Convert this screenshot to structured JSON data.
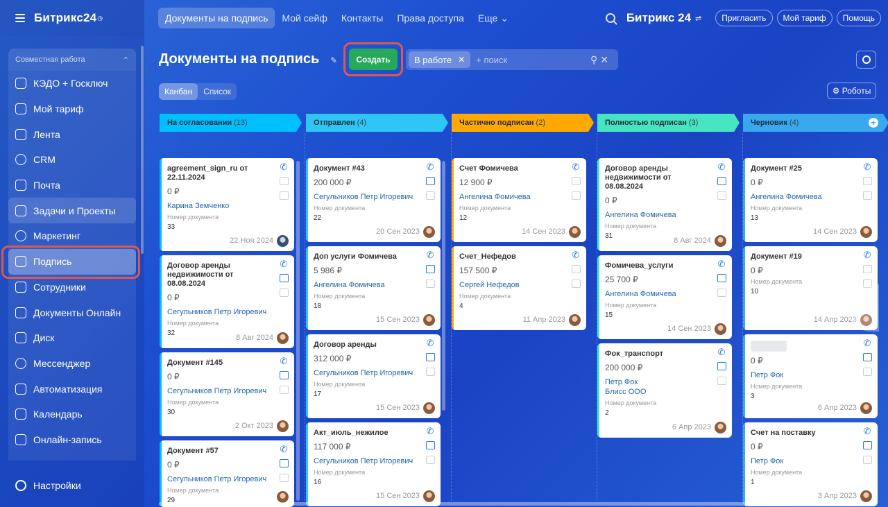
{
  "app": {
    "logo": "Битрикс24",
    "brand": "Битрикс 24"
  },
  "topnav": [
    "Документы на подпись",
    "Мой сейф",
    "Контакты",
    "Права доступа",
    "Еще ⌄"
  ],
  "topright": {
    "invite": "Пригласить",
    "tariff": "Мой тариф",
    "help": "Помощь"
  },
  "sidebar": {
    "group_label": "Совместная работа",
    "items": [
      {
        "label": "КЭДО + Госключ"
      },
      {
        "label": "Мой тариф"
      },
      {
        "label": "Лента"
      },
      {
        "label": "CRM"
      },
      {
        "label": "Почта"
      },
      {
        "label": "Задачи и Проекты"
      },
      {
        "label": "Маркетинг"
      },
      {
        "label": "Подпись"
      },
      {
        "label": "Сотрудники"
      },
      {
        "label": "Документы Онлайн"
      },
      {
        "label": "Диск"
      },
      {
        "label": "Мессенджер"
      },
      {
        "label": "Автоматизация"
      },
      {
        "label": "Календарь"
      },
      {
        "label": "Онлайн-запись"
      }
    ],
    "settings": "Настройки"
  },
  "page": {
    "title": "Документы на подпись",
    "create": "Создать",
    "filter_tag": "В работе",
    "search_placeholder": "+ поиск",
    "view_kanban": "Канбан",
    "view_list": "Список",
    "robots": "Роботы"
  },
  "columns": [
    {
      "name": "На согласовании",
      "count": "(13)",
      "color": "#00bfff"
    },
    {
      "name": "Отправлен",
      "count": "(4)",
      "color": "#2fc6f6"
    },
    {
      "name": "Частично подписан",
      "count": "(2)",
      "color": "#ffa900"
    },
    {
      "name": "Полностью подписан",
      "count": "(3)",
      "color": "#47e4c2"
    },
    {
      "name": "Черновик",
      "count": "(4)",
      "color": "#39a8ef"
    }
  ],
  "field_label": "Номер документа",
  "cards": [
    [
      {
        "title": "agreement_sign_ru от 22.11.2024",
        "sum": "0 ₽",
        "person": "Карина Земченко",
        "num": "33",
        "date": "22 Ноя 2024"
      },
      {
        "title": "Договор аренды недвижимости от 08.08.2024",
        "sum": "0 ₽",
        "person": "Сегульников Петр Игоревич",
        "num": "32",
        "date": "8 Авг 2024"
      },
      {
        "title": "Документ #145",
        "sum": "0 ₽",
        "person": "Сегульников Петр Игоревич",
        "num": "30",
        "date": "2 Окт 2023"
      },
      {
        "title": "Документ #57",
        "sum": "0 ₽",
        "person": "Сегульников Петр Игоревич",
        "num": "29",
        "date": ""
      }
    ],
    [
      {
        "title": "Документ #43",
        "sum": "200 000 ₽",
        "person": "Сегульников Петр Игоревич",
        "num": "22",
        "date": "20 Сен 2023"
      },
      {
        "title": "Доп услуги Фомичева",
        "sum": "5 986 ₽",
        "person": "Ангелина Фомичева",
        "num": "18",
        "date": "15 Сен 2023"
      },
      {
        "title": "Договор аренды",
        "sum": "312 000 ₽",
        "person": "Сегульников Петр Игоревич",
        "num": "17",
        "date": "15 Сен 2023"
      },
      {
        "title": "Акт_июль_нежилое",
        "sum": "117 000 ₽",
        "person": "Сегульников Петр Игоревич",
        "num": "16",
        "date": "15 Сен 2023"
      }
    ],
    [
      {
        "title": "Счет Фомичева",
        "sum": "12 900 ₽",
        "person": "Ангелина Фомичева",
        "num": "12",
        "date": "14 Сен 2023"
      },
      {
        "title": "Счет_Нефедов",
        "sum": "157 500 ₽",
        "person": "Сергей Нефедов",
        "num": "4",
        "date": "11 Апр 2023"
      }
    ],
    [
      {
        "title": "Договор аренды недвижимости от 08.08.2024",
        "sum": "0 ₽",
        "person": "Ангелина Фомичева",
        "num": "31",
        "date": "8 Авг 2024"
      },
      {
        "title": "Фомичева_услуги",
        "sum": "25 700 ₽",
        "person": "Ангелина Фомичева",
        "num": "15",
        "date": "14 Сен 2023"
      },
      {
        "title": "Фок_транспорт",
        "sum": "200 000 ₽",
        "person": "Петр Фок",
        "person2": "Блисс ООО",
        "num": "2",
        "date": "6 Апр 2023"
      }
    ],
    [
      {
        "title": "Документ #25",
        "sum": "0 ₽",
        "person": "Ангелина Фомичева",
        "num": "13",
        "date": "14 Сен 2023"
      },
      {
        "title": "Документ #19",
        "sum": "0 ₽",
        "person": "",
        "num": "10",
        "date": "14 Апр 2023"
      },
      {
        "title": "",
        "sum": "0 ₽",
        "person": "Петр Фок",
        "num": "3",
        "date": "6 Апр 2023"
      },
      {
        "title": "Счет на поставку",
        "sum": "0 ₽",
        "person": "Петр Фок",
        "num": "1",
        "date": "3 Апр 2023"
      }
    ]
  ]
}
